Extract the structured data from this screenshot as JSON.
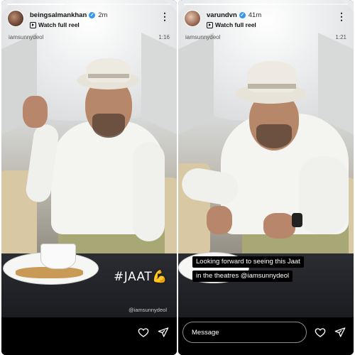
{
  "stories": [
    {
      "username": "beingsalmankhan",
      "time": "2m",
      "reel_link": "Watch full reel",
      "tagged_user": "iamsunnydeol",
      "duration": "1:16",
      "hashtag": "#JAAT",
      "hashtag_emoji": "💪",
      "watermark": "@iamsunnydeol",
      "progress": 0.35
    },
    {
      "username": "varundvn",
      "time": "41m",
      "reel_link": "Watch full reel",
      "tagged_user": "iamsunnydeol",
      "duration": "1:21",
      "caption_lines": [
        "Looking forward to seeing this Jaat",
        "in the theatres @iamsunnydeol"
      ],
      "message_placeholder": "Message",
      "progress": 0.55
    }
  ],
  "icons": {
    "verified": "verified-badge-icon",
    "more": "more-options-icon",
    "reel": "reel-icon",
    "heart": "heart-icon",
    "send": "send-icon"
  },
  "colors": {
    "verified": "#3797f0",
    "background": "#000000"
  }
}
